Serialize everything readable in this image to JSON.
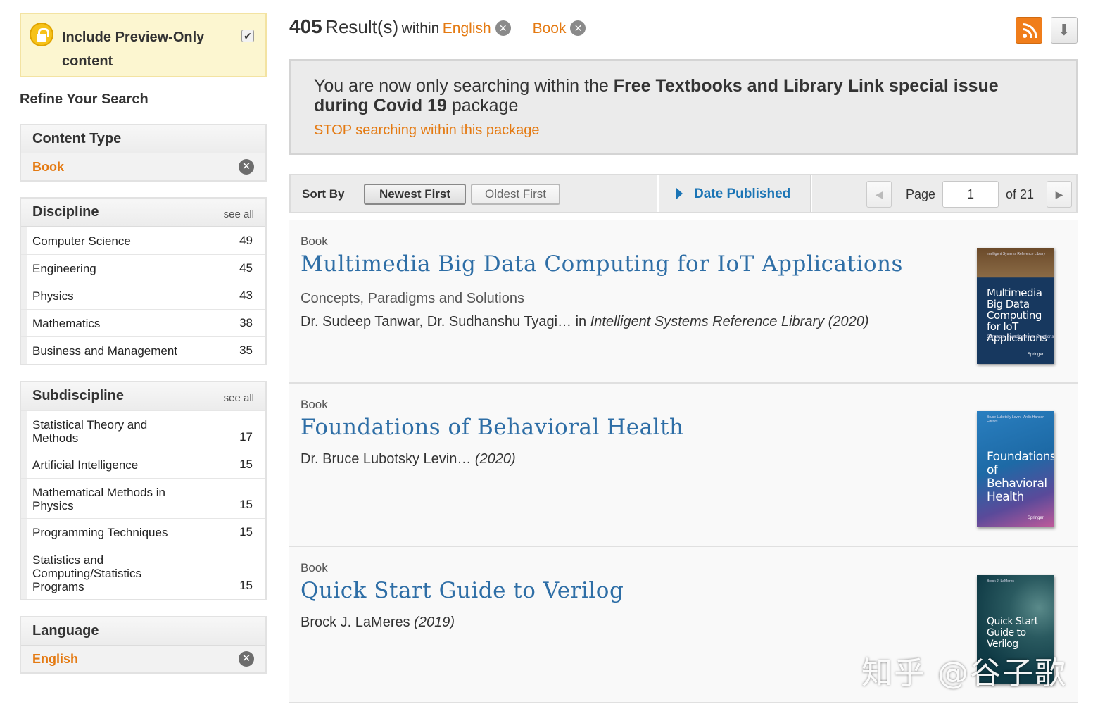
{
  "sidebar": {
    "preview": {
      "label": "Include Preview-Only content",
      "checked": true
    },
    "refine_title": "Refine Your Search",
    "content_type": {
      "title": "Content Type",
      "selected": "Book"
    },
    "discipline": {
      "title": "Discipline",
      "see_all": "see all",
      "items": [
        {
          "label": "Computer Science",
          "count": "49"
        },
        {
          "label": "Engineering",
          "count": "45"
        },
        {
          "label": "Physics",
          "count": "43"
        },
        {
          "label": "Mathematics",
          "count": "38"
        },
        {
          "label": "Business and Management",
          "count": "35"
        }
      ]
    },
    "subdiscipline": {
      "title": "Subdiscipline",
      "see_all": "see all",
      "items": [
        {
          "label": "Statistical Theory and Methods",
          "count": "17"
        },
        {
          "label": "Artificial Intelligence",
          "count": "15"
        },
        {
          "label": "Mathematical Methods in Physics",
          "count": "15"
        },
        {
          "label": "Programming Techniques",
          "count": "15"
        },
        {
          "label": "Statistics and Computing/Statistics Programs",
          "count": "15"
        }
      ]
    },
    "language": {
      "title": "Language",
      "selected": "English"
    }
  },
  "header": {
    "count": "405",
    "results_word": "Result(s)",
    "within_word": "within",
    "filters": [
      "English",
      "Book"
    ]
  },
  "package": {
    "text_pre": "You are now only searching within the ",
    "text_bold": "Free Textbooks and Library Link special issue during Covid 19",
    "text_post": " package",
    "stop_link": "STOP searching within this package"
  },
  "sortbar": {
    "sort_by_label": "Sort By",
    "newest": "Newest First",
    "oldest": "Oldest First",
    "date_published": "Date Published",
    "page_label": "Page",
    "page_value": "1",
    "page_of": "of 21"
  },
  "results": [
    {
      "content_type": "Book",
      "title": "Multimedia Big Data Computing for IoT Applications",
      "subtitle": "Concepts, Paradigms and Solutions",
      "authors": "Dr. Sudeep Tanwar, Dr. Sudhanshu Tyagi… in ",
      "series": "Intelligent Systems Reference Library",
      "year": "(2020)",
      "cover_title": "Multimedia Big Data Computing for IoT Applications",
      "cover_subtitle": "Concepts, Paradigms and Solutions",
      "cover_color": "#17385f"
    },
    {
      "content_type": "Book",
      "title": "Foundations of Behavioral Health",
      "subtitle": "",
      "authors": "Dr. Bruce Lubotsky Levin… ",
      "series": "",
      "year": "(2020)",
      "cover_title": "Foundations of Behavioral Health",
      "cover_subtitle": "Bruce Lubotsky Levin · Ardis Hanson Editors",
      "cover_color": "#1d6aa6"
    },
    {
      "content_type": "Book",
      "title": "Quick Start Guide to Verilog",
      "subtitle": "",
      "authors": "Brock J. LaMeres ",
      "series": "",
      "year": "(2019)",
      "cover_title": "Quick Start Guide to Verilog",
      "cover_subtitle": "Brock J. LaMeres",
      "cover_color": "#0f3a45"
    }
  ],
  "watermark": "知乎 @谷子歌",
  "colors": {
    "accent_orange": "#e47a12",
    "link_blue": "#2e6ea6",
    "rss_orange": "#f07d1a"
  },
  "icons": [
    "lock-icon",
    "checkbox-icon",
    "remove-icon",
    "rss-icon",
    "download-icon",
    "triangle-right-icon",
    "chevron-left-icon",
    "chevron-right-icon"
  ]
}
